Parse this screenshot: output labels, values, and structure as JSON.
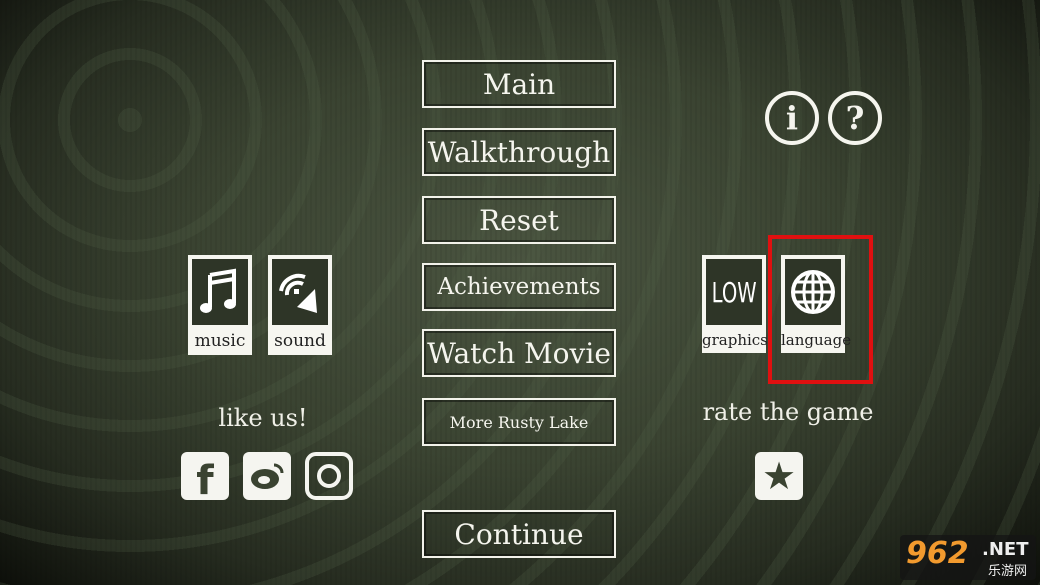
{
  "menu": {
    "main": "Main",
    "walkthrough": "Walkthrough",
    "reset": "Reset",
    "achievements": "Achievements",
    "watch_movie": "Watch Movie",
    "more": "More Rusty Lake",
    "continue": "Continue"
  },
  "settings": {
    "music": "music",
    "sound": "sound",
    "graphics_value": "LOW",
    "graphics": "graphics",
    "language": "language"
  },
  "social": {
    "like_us": "like us!",
    "rate": "rate the game"
  },
  "icons": {
    "info": "i",
    "help": "?"
  },
  "watermark": {
    "brand": "962",
    "suffix": ".NET",
    "sub": "乐游网"
  },
  "colors": {
    "highlight": "#e01010",
    "card": "#f6f6f0",
    "background": "#3a4331"
  }
}
